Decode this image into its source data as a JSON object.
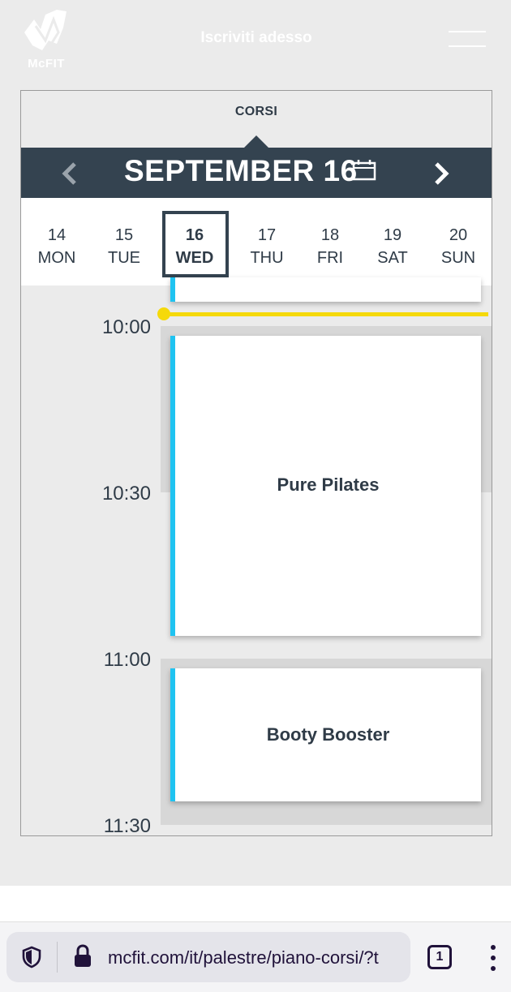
{
  "header": {
    "logo_text": "McFIT",
    "signup_label": "Iscriviti adesso",
    "menu_icon": "hamburger-menu-icon",
    "colors": {
      "header_text": "#ffffff"
    }
  },
  "calendar": {
    "tab_label": "CORSI",
    "month_title": "SEPTEMBER 16",
    "prev_icon": "chevron-left-icon",
    "next_icon": "chevron-right-icon",
    "calendar_icon": "calendar-icon",
    "days": [
      {
        "num": "14",
        "name": "MON"
      },
      {
        "num": "15",
        "name": "TUE"
      },
      {
        "num": "16",
        "name": "WED",
        "selected": true
      },
      {
        "num": "17",
        "name": "THU"
      },
      {
        "num": "18",
        "name": "FRI"
      },
      {
        "num": "19",
        "name": "SAT"
      },
      {
        "num": "20",
        "name": "SUN"
      }
    ],
    "colors": {
      "bar": "#344350",
      "accent": "#1fc3f1",
      "now_line": "#f5d90a"
    }
  },
  "schedule": {
    "times": [
      "10:00",
      "10:30",
      "11:00",
      "11:30"
    ],
    "events": [
      {
        "title": "Pure Pilates"
      },
      {
        "title": "Booty Booster"
      }
    ]
  },
  "browser": {
    "url": "mcfit.com/it/palestre/piano-corsi/?t",
    "tab_count": "1",
    "shield_icon": "shield-icon",
    "lock_icon": "lock-icon",
    "menu_icon": "kebab-menu-icon"
  }
}
